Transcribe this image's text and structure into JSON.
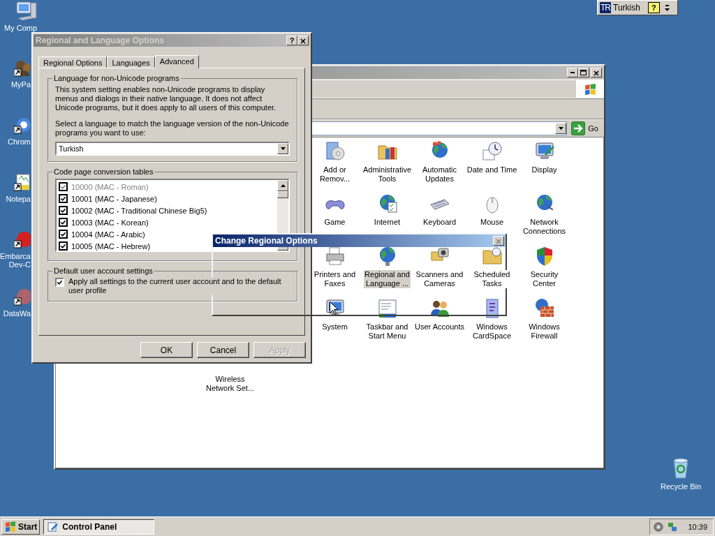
{
  "language_bar": {
    "badge": "TR",
    "language": "Turkish",
    "help_button": "?"
  },
  "desktop_icons": [
    {
      "lines": [
        "My Comp"
      ]
    },
    {
      "lines": [
        "MyPa"
      ]
    },
    {
      "lines": [
        "Chrom"
      ]
    },
    {
      "lines": [
        "Notepa"
      ]
    },
    {
      "lines": [
        "Embarca",
        "Dev-C"
      ]
    },
    {
      "lines": [
        "DataWa"
      ]
    }
  ],
  "control_panel": {
    "address_bar": {
      "go_button": "Go"
    },
    "items": [
      {
        "lines": [
          "Add or",
          "Remov..."
        ],
        "selected": false
      },
      {
        "lines": [
          "Administrative",
          "Tools"
        ],
        "selected": false
      },
      {
        "lines": [
          "Automatic",
          "Updates"
        ],
        "selected": false
      },
      {
        "lines": [
          "Date and Time"
        ],
        "selected": false
      },
      {
        "lines": [
          "Display"
        ],
        "selected": false
      },
      {
        "lines": [
          "Game"
        ],
        "selected": false
      },
      {
        "lines": [
          "Internet"
        ],
        "selected": false
      },
      {
        "lines": [
          "Keyboard"
        ],
        "selected": false
      },
      {
        "lines": [
          "Mouse"
        ],
        "selected": false
      },
      {
        "lines": [
          "Network",
          "Connections"
        ],
        "selected": false
      },
      {
        "lines": [
          "Printers and",
          "Faxes"
        ],
        "selected": false
      },
      {
        "lines": [
          "Regional and",
          "Language ..."
        ],
        "selected": true
      },
      {
        "lines": [
          "Scanners and",
          "Cameras"
        ],
        "selected": false
      },
      {
        "lines": [
          "Scheduled",
          "Tasks"
        ],
        "selected": false
      },
      {
        "lines": [
          "Security",
          "Center"
        ],
        "selected": false
      },
      {
        "lines": [
          "System"
        ],
        "selected": false
      },
      {
        "lines": [
          "Taskbar and",
          "Start Menu"
        ],
        "selected": false
      },
      {
        "lines": [
          "User Accounts"
        ],
        "selected": false
      },
      {
        "lines": [
          "Windows",
          "CardSpace"
        ],
        "selected": false
      },
      {
        "lines": [
          "Windows",
          "Firewall"
        ],
        "selected": false
      },
      {
        "lines": [
          "Wireless",
          "Network Set..."
        ],
        "selected": false
      }
    ]
  },
  "regional_dialog": {
    "title": "Regional and Language Options",
    "help_button": "?",
    "tabs": [
      {
        "label": "Regional Options",
        "selected": false
      },
      {
        "label": "Languages",
        "selected": false
      },
      {
        "label": "Advanced",
        "selected": true
      }
    ],
    "non_unicode_group": {
      "title": "Language for non-Unicode programs",
      "description": "This system setting enables non-Unicode programs to display menus and dialogs in their native language. It does not affect Unicode programs, but it does apply to all users of this computer.",
      "prompt": "Select a language to match the language version of the non-Unicode programs you want to use:",
      "language_select": {
        "value": "Turkish"
      }
    },
    "code_page_group": {
      "title": "Code page conversion tables",
      "items": [
        {
          "label": "10000 (MAC - Roman)",
          "checked": true,
          "disabled": true
        },
        {
          "label": "10001 (MAC - Japanese)",
          "checked": true,
          "disabled": false
        },
        {
          "label": "10002 (MAC - Traditional Chinese Big5)",
          "checked": true,
          "disabled": false
        },
        {
          "label": "10003 (MAC - Korean)",
          "checked": true,
          "disabled": false
        },
        {
          "label": "10004 (MAC - Arabic)",
          "checked": true,
          "disabled": false
        },
        {
          "label": "10005 (MAC - Hebrew)",
          "checked": true,
          "disabled": false
        }
      ]
    },
    "default_user_group": {
      "title": "Default user account settings",
      "checkbox": {
        "label": "Apply all settings to the current user account and to the default user profile",
        "checked": true
      }
    },
    "buttons": [
      {
        "label": "OK",
        "disabled": false
      },
      {
        "label": "Cancel",
        "disabled": false
      },
      {
        "label": "Apply",
        "disabled": true
      }
    ]
  },
  "change_regional_options": {
    "title": "Change Regional Options"
  },
  "recycle_bin": {
    "label": "Recycle Bin"
  },
  "taskbar": {
    "start_button": "Start",
    "tasks": [
      {
        "label": "Control Panel",
        "selected": true
      }
    ],
    "clock": "10:39"
  }
}
